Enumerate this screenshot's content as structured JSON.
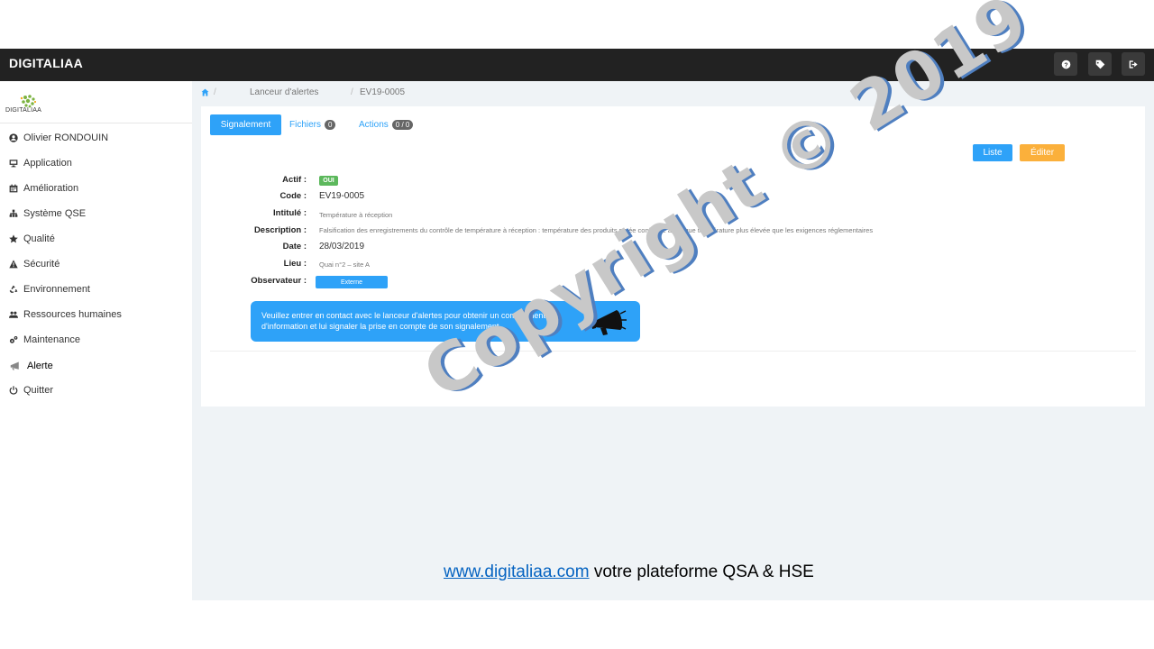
{
  "header": {
    "brand": "DIGITALIAA",
    "icons": [
      "help-icon",
      "tag-icon",
      "sign-out-icon"
    ]
  },
  "sidebar": {
    "logo_text": "DIGITALIAA",
    "items": [
      {
        "label": "Olivier RONDOUIN",
        "icon": "user-icon"
      },
      {
        "label": "Application",
        "icon": "monitor-icon"
      },
      {
        "label": "Amélioration",
        "icon": "calendar-icon"
      },
      {
        "label": "Système QSE",
        "icon": "sitemap-icon"
      },
      {
        "label": "Qualité",
        "icon": "star-icon"
      },
      {
        "label": "Sécurité",
        "icon": "warning-icon"
      },
      {
        "label": "Environnement",
        "icon": "recycle-icon"
      },
      {
        "label": "Ressources humaines",
        "icon": "users-icon"
      },
      {
        "label": "Maintenance",
        "icon": "cogs-icon"
      },
      {
        "label": "Alerte",
        "icon": "megaphone-icon"
      },
      {
        "label": "Quitter",
        "icon": "power-icon"
      }
    ]
  },
  "breadcrumb": {
    "sep": "/",
    "items": [
      "Lanceur d'alertes",
      "EV19-0005"
    ]
  },
  "tabs": {
    "signalement": "Signalement",
    "fichiers": "Fichiers",
    "fichiers_count": "0",
    "actions": "Actions",
    "actions_count": "0 / 0"
  },
  "buttons": {
    "liste": "Liste",
    "editer": "Éditer"
  },
  "fields": {
    "actif_label": "Actif :",
    "actif_value": "OUI",
    "code_label": "Code :",
    "code_value": "EV19-0005",
    "intitule_label": "Intitulé :",
    "intitule_value": "Température  à réception",
    "description_label": "Description :",
    "description_value": "Falsification  des enregistrements   du contrôle de température  à réception  : température  des produits notée conforme alors que température  plus élevée  que les exigences  réglementaires",
    "date_label": "Date :",
    "date_value": "28/03/2019",
    "lieu_label": "Lieu :",
    "lieu_value": "Quai n°2 – site A",
    "observateur_label": "Observateur :",
    "observateur_value": "Externe"
  },
  "alert": {
    "text": "Veuillez entrer en contact avec le lanceur d'alertes pour obtenir un complément d'information et lui signaler la prise en compte de son signalement"
  },
  "watermark": "Copyright © 2019",
  "footer": {
    "link": "www.digitaliaa.com",
    "text": " votre plateforme QSA & HSE"
  },
  "colors": {
    "primary": "#2ea2f8",
    "warning": "#fbb03b",
    "success": "#5cb85c",
    "topbar": "#222222"
  }
}
